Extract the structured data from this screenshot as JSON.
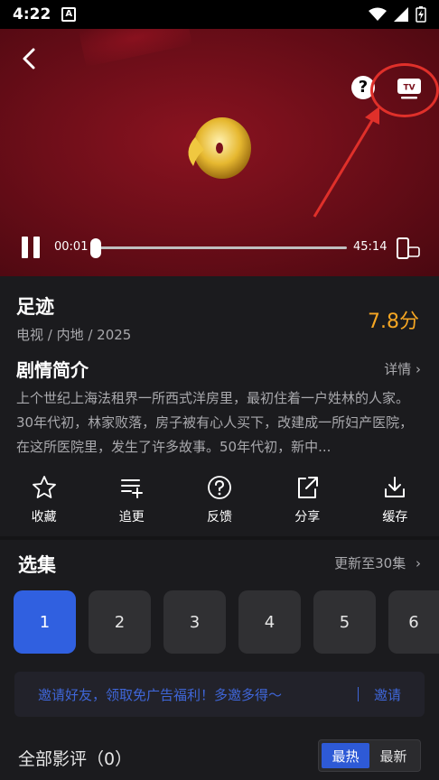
{
  "status": {
    "time": "4:22",
    "notification_badge": "A"
  },
  "player": {
    "current_time": "00:01",
    "total_time": "45:14",
    "progress": 0.0004,
    "help_label": "?",
    "cast_label": "TV"
  },
  "show": {
    "title": "足迹",
    "meta": "电视 / 内地 / 2025",
    "score": "7.8分",
    "synopsis_title": "剧情简介",
    "detail_label": "详情 ›",
    "synopsis": "上个世纪上海法租界一所西式洋房里，最初住着一户姓林的人家。30年代初，林家败落，房子被有心人买下，改建成一所妇产医院，在这所医院里，发生了许多故事。50年代初，新中..."
  },
  "actions": [
    {
      "label": "收藏",
      "icon": "star-icon"
    },
    {
      "label": "追更",
      "icon": "playlist-add-icon"
    },
    {
      "label": "反馈",
      "icon": "help-circle-icon"
    },
    {
      "label": "分享",
      "icon": "share-icon"
    },
    {
      "label": "缓存",
      "icon": "download-icon"
    }
  ],
  "episodes": {
    "title": "选集",
    "update_label": "更新至30集",
    "items": [
      "1",
      "2",
      "3",
      "4",
      "5",
      "6"
    ],
    "selected": "1"
  },
  "invite": {
    "text": "邀请好友，领取免广告福利！多邀多得～",
    "button": "邀请"
  },
  "reviews": {
    "title": "全部影评（0）",
    "sort_hot": "最热",
    "sort_new": "最新"
  },
  "colors": {
    "accent": "#3060e0",
    "score": "#f5a623",
    "annotation": "#e0302a",
    "video_bg": "#7a101c"
  }
}
